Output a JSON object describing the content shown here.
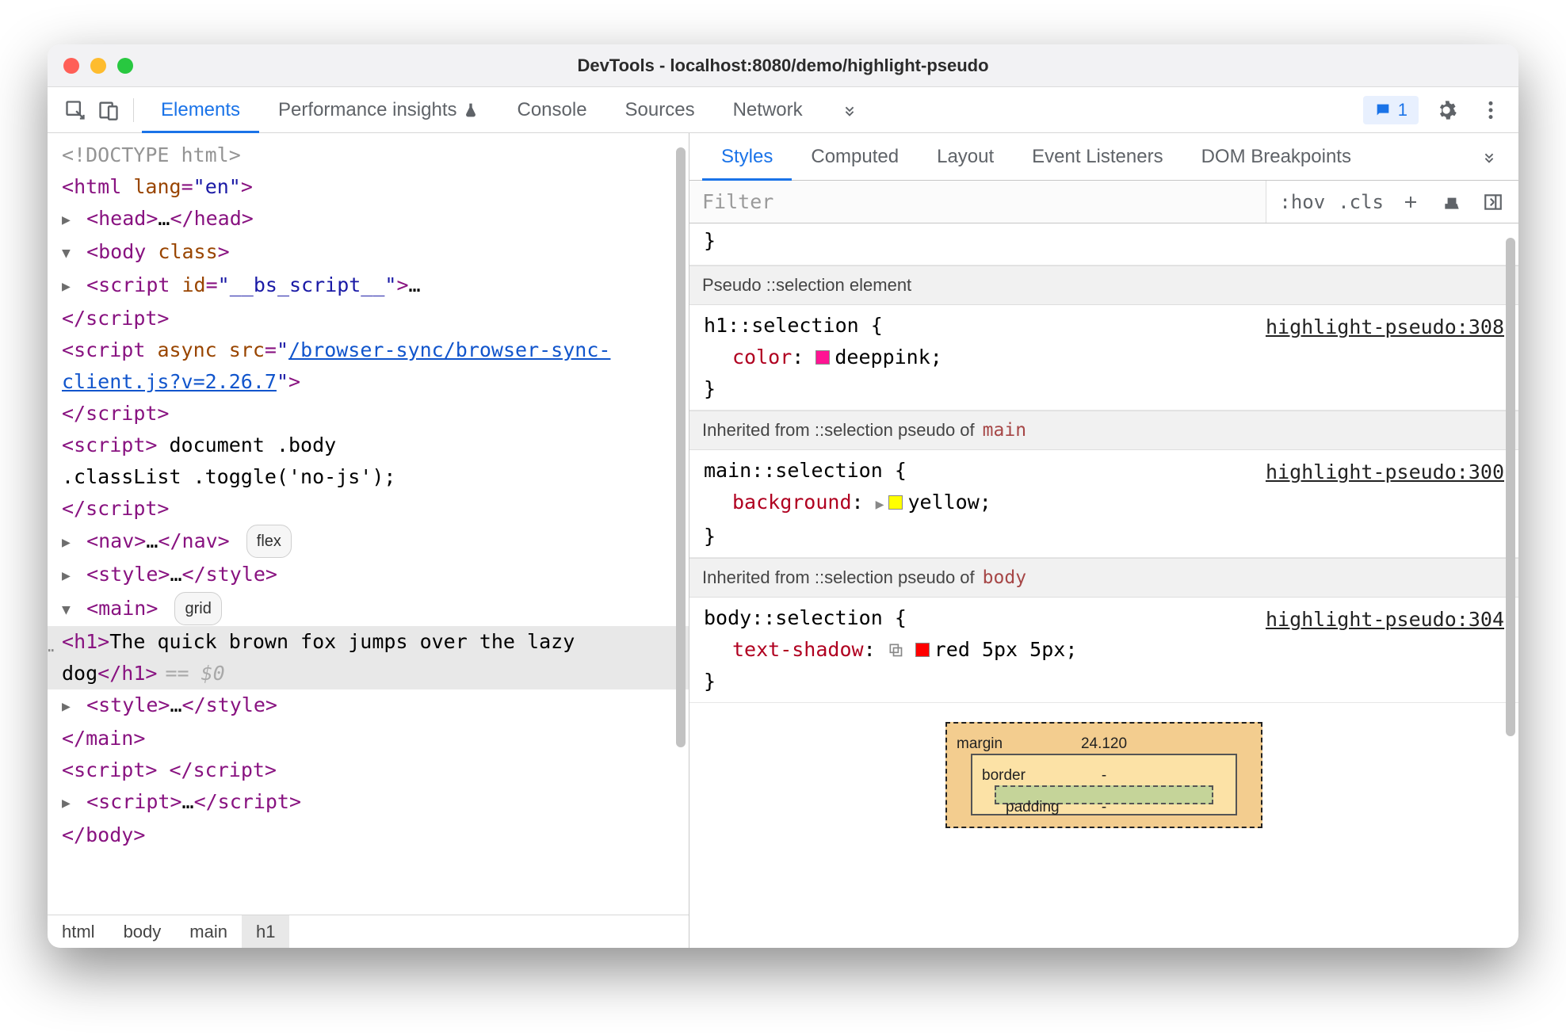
{
  "window": {
    "title": "DevTools - localhost:8080/demo/highlight-pseudo"
  },
  "toolbar": {
    "tabs": [
      "Elements",
      "Performance insights",
      "Console",
      "Sources",
      "Network"
    ],
    "active_tab": "Elements",
    "issues_count": "1"
  },
  "dom": {
    "doctype": "<!DOCTYPE html>",
    "html_open": {
      "tag": "html",
      "attr_name": "lang",
      "attr_val": "en"
    },
    "head": {
      "open": "head",
      "ellipsis": "…",
      "close": "head"
    },
    "body_open": {
      "tag": "body",
      "attr_name": "class"
    },
    "bs_script": {
      "tag": "script",
      "attr_name": "id",
      "attr_val": "__bs_script__",
      "ellipsis": "…",
      "close": "script"
    },
    "async_script": {
      "tag": "script",
      "attr_async": "async",
      "attr_src_name": "src",
      "link_text": "/browser-sync/browser-sync-client.js?v=2.26.7",
      "close": "script"
    },
    "inline_script": {
      "tag": "script",
      "code_l1": " document .body ",
      "code_l2": ".classList .toggle('no-js');",
      "close": "script"
    },
    "nav": {
      "open": "nav",
      "ellipsis": "…",
      "close": "nav",
      "badge": "flex"
    },
    "style1": {
      "open": "style",
      "ellipsis": "…",
      "close": "style"
    },
    "main": {
      "open": "main",
      "badge": "grid"
    },
    "h1": {
      "open": "h1",
      "text_l1": "The quick brown fox jumps ",
      "text_l2": "over the lazy dog",
      "close": "h1",
      "marker": "== $0"
    },
    "style2": {
      "open": "style",
      "ellipsis": "…",
      "close": "style"
    },
    "main_close": "main",
    "empty_script": {
      "open": "script",
      "close": "script"
    },
    "coll_script": {
      "open": "script",
      "ellipsis": "…",
      "close": "script"
    },
    "body_close": "body"
  },
  "crumbs": [
    "html",
    "body",
    "main",
    "h1"
  ],
  "crumbs_active": "h1",
  "styles_panel": {
    "sub_tabs": [
      "Styles",
      "Computed",
      "Layout",
      "Event Listeners",
      "DOM Breakpoints"
    ],
    "active_sub_tab": "Styles",
    "filter_placeholder": "Filter",
    "toggles": {
      "hov": ":hov",
      "cls": ".cls"
    },
    "sections": {
      "sec0_head": "Pseudo ::selection element",
      "rule0": {
        "selector": "h1::selection {",
        "source": "highlight-pseudo:308",
        "prop_name": "color",
        "prop_value": "deeppink",
        "swatch": "#ff1493",
        "close": "}"
      },
      "sec1_head": "Inherited from ::selection pseudo of ",
      "sec1_ref": "main",
      "rule1": {
        "selector": "main::selection {",
        "source": "highlight-pseudo:300",
        "prop_name": "background",
        "prop_value": "yellow",
        "swatch": "#ffff00",
        "close": "}"
      },
      "sec2_head": "Inherited from ::selection pseudo of ",
      "sec2_ref": "body",
      "rule2": {
        "selector": "body::selection {",
        "source": "highlight-pseudo:304",
        "prop_name": "text-shadow",
        "prop_value": "red 5px 5px",
        "swatch": "#ff0000",
        "close": "}"
      }
    },
    "box_model": {
      "margin_label": "margin",
      "margin_top": "24.120",
      "border_label": "border",
      "border_top": "-",
      "padding_label": "padding",
      "padding_top": "-"
    }
  }
}
